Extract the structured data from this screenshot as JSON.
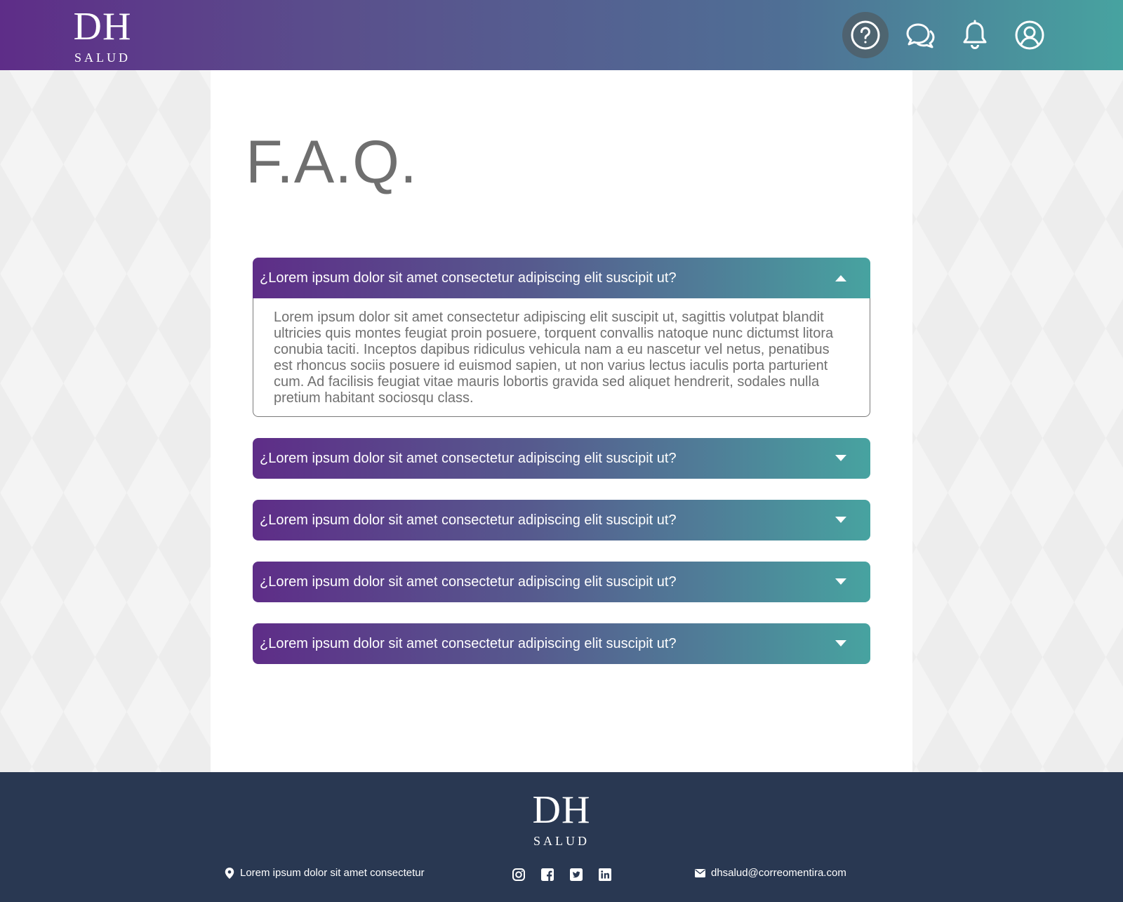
{
  "header": {
    "logo": {
      "mark": "DH",
      "subtitle": "SALUD"
    },
    "icons": [
      {
        "name": "help-icon",
        "active": true
      },
      {
        "name": "chat-icon",
        "active": false
      },
      {
        "name": "bell-icon",
        "active": false
      },
      {
        "name": "user-icon",
        "active": false
      }
    ]
  },
  "colors": {
    "gradient_start": "#5e2d88",
    "gradient_end": "#47a3a0",
    "footer_bg": "#293852",
    "title_text": "#6f6f6f"
  },
  "main": {
    "title": "F.A.Q.",
    "faqs": [
      {
        "question": "¿Lorem ipsum dolor sit amet consectetur adipiscing elit suscipit ut?",
        "answer": "Lorem ipsum dolor sit amet consectetur adipiscing elit suscipit ut, sagittis volutpat blandit ultricies quis montes feugiat proin posuere, torquent convallis natoque nunc dictumst litora conubia taciti. Inceptos dapibus ridiculus vehicula nam a eu nascetur vel netus, penatibus est rhoncus sociis posuere id euismod sapien, ut non varius lectus iaculis porta parturient cum. Ad facilisis feugiat vitae mauris lobortis gravida sed aliquet hendrerit, sodales nulla pretium habitant sociosqu class.",
        "expanded": true
      },
      {
        "question": "¿Lorem ipsum dolor sit amet consectetur adipiscing elit suscipit ut?",
        "expanded": false
      },
      {
        "question": "¿Lorem ipsum dolor sit amet consectetur adipiscing elit suscipit ut?",
        "expanded": false
      },
      {
        "question": "¿Lorem ipsum dolor sit amet consectetur adipiscing elit suscipit ut?",
        "expanded": false
      },
      {
        "question": "¿Lorem ipsum dolor sit amet consectetur adipiscing elit suscipit ut?",
        "expanded": false
      }
    ]
  },
  "footer": {
    "logo": {
      "mark": "DH",
      "subtitle": "SALUD"
    },
    "address": "Lorem ipsum dolor sit amet consectetur",
    "address_icon": "location-pin-icon",
    "socials": [
      "instagram-icon",
      "facebook-icon",
      "twitter-icon",
      "linkedin-icon"
    ],
    "email": "dhsalud@correomentira.com",
    "email_icon": "envelope-icon"
  }
}
